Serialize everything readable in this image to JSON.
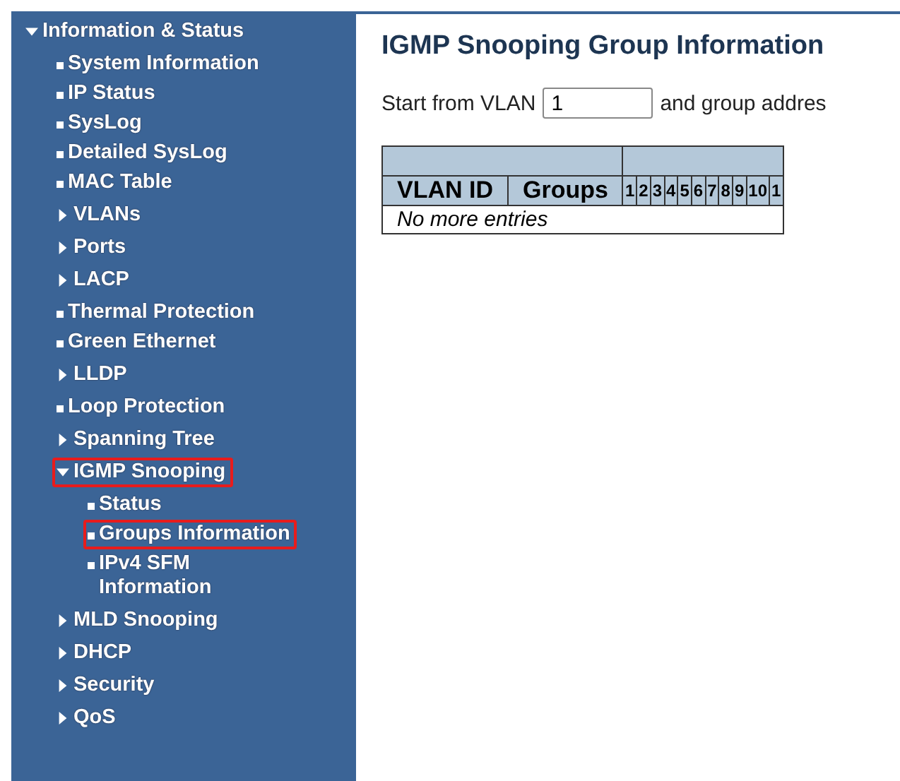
{
  "sidebar": {
    "items": [
      {
        "label": "Information & Status",
        "kind": "folder",
        "expanded": true,
        "highlighted": false,
        "children": [
          {
            "label": "System Information",
            "kind": "leaf",
            "highlighted": false
          },
          {
            "label": "IP Status",
            "kind": "leaf",
            "highlighted": false
          },
          {
            "label": "SysLog",
            "kind": "leaf",
            "highlighted": false
          },
          {
            "label": "Detailed SysLog",
            "kind": "leaf",
            "highlighted": false
          },
          {
            "label": "MAC Table",
            "kind": "leaf",
            "highlighted": false
          },
          {
            "label": "VLANs",
            "kind": "folder",
            "expanded": false,
            "highlighted": false
          },
          {
            "label": "Ports",
            "kind": "folder",
            "expanded": false,
            "highlighted": false
          },
          {
            "label": "LACP",
            "kind": "folder",
            "expanded": false,
            "highlighted": false
          },
          {
            "label": "Thermal Protection",
            "kind": "leaf",
            "highlighted": false
          },
          {
            "label": "Green Ethernet",
            "kind": "leaf",
            "highlighted": false
          },
          {
            "label": "LLDP",
            "kind": "folder",
            "expanded": false,
            "highlighted": false
          },
          {
            "label": "Loop Protection",
            "kind": "leaf",
            "highlighted": false
          },
          {
            "label": "Spanning Tree",
            "kind": "folder",
            "expanded": false,
            "highlighted": false
          },
          {
            "label": "IGMP Snooping",
            "kind": "folder",
            "expanded": true,
            "highlighted": true,
            "children": [
              {
                "label": "Status",
                "kind": "leaf",
                "highlighted": false
              },
              {
                "label": "Groups Information",
                "kind": "leaf",
                "highlighted": true
              },
              {
                "label": "IPv4 SFM Information",
                "kind": "leaf",
                "highlighted": false
              }
            ]
          },
          {
            "label": "MLD Snooping",
            "kind": "folder",
            "expanded": false,
            "highlighted": false
          },
          {
            "label": "DHCP",
            "kind": "folder",
            "expanded": false,
            "highlighted": false
          },
          {
            "label": "Security",
            "kind": "folder",
            "expanded": false,
            "highlighted": false
          },
          {
            "label": "QoS",
            "kind": "folder",
            "expanded": false,
            "highlighted": false
          }
        ]
      }
    ]
  },
  "title": "IGMP Snooping Group Information",
  "filter": {
    "label": "Start from VLAN",
    "value": "1",
    "trailing_text": "and group addres"
  },
  "table": {
    "columns": [
      "VLAN ID",
      "Groups"
    ],
    "port_columns": [
      "1",
      "2",
      "3",
      "4",
      "5",
      "6",
      "7",
      "8",
      "9",
      "10",
      "1"
    ],
    "empty_text": "No more entries"
  }
}
